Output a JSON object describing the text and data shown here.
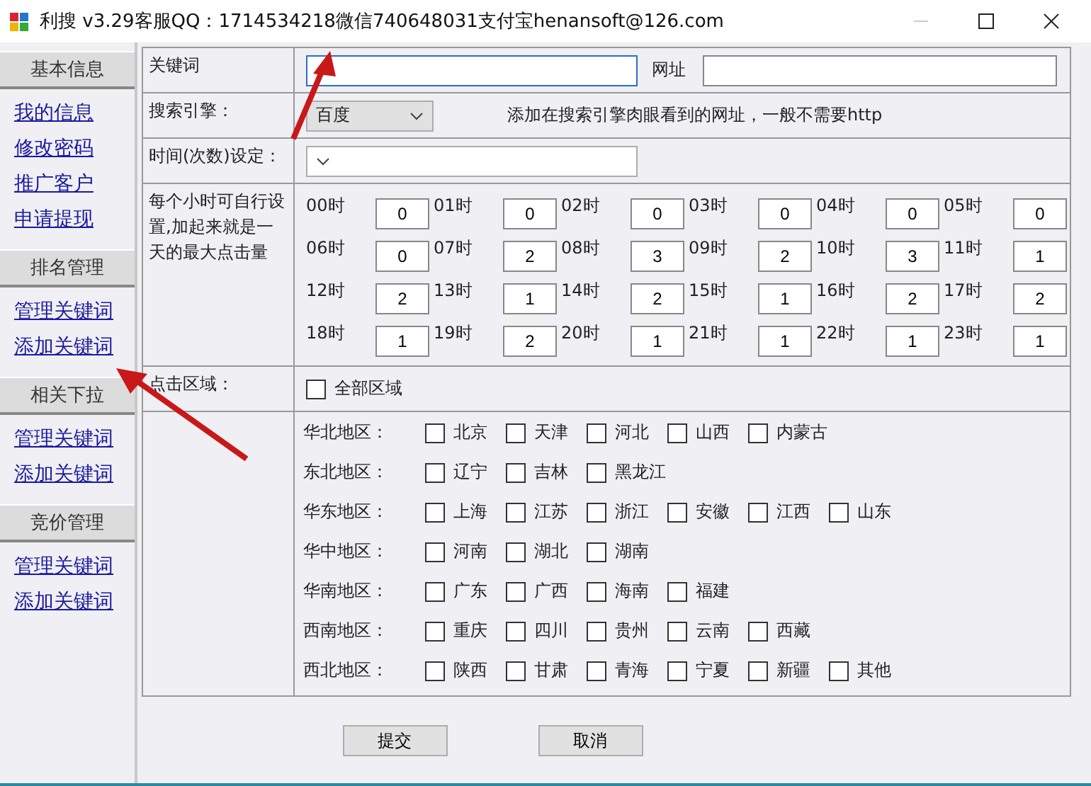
{
  "window": {
    "title": "利搜 v3.29客服QQ：1714534218微信740648031支付宝henansoft@126.com"
  },
  "sidebar": {
    "sections": [
      {
        "title": "基本信息",
        "links": [
          "我的信息",
          "修改密码",
          "推广客户",
          "申请提现"
        ]
      },
      {
        "title": "排名管理",
        "links": [
          "管理关键词",
          "添加关键词"
        ]
      },
      {
        "title": "相关下拉",
        "links": [
          "管理关键词",
          "添加关键词"
        ]
      },
      {
        "title": "竞价管理",
        "links": [
          "管理关键词",
          "添加关键词"
        ]
      }
    ]
  },
  "form": {
    "keyword": {
      "label": "关键词"
    },
    "url": {
      "label": "网址"
    },
    "engine": {
      "label": "搜索引擎：",
      "value": "百度",
      "hint": "添加在搜索引擎肉眼看到的网址，一般不需要http"
    },
    "time": {
      "label": "时间(次数)设定："
    },
    "hours_note": "每个小时可自行设置,加起来就是一天的最大点击量",
    "hours": [
      {
        "label": "00时",
        "value": "0"
      },
      {
        "label": "01时",
        "value": "0"
      },
      {
        "label": "02时",
        "value": "0"
      },
      {
        "label": "03时",
        "value": "0"
      },
      {
        "label": "04时",
        "value": "0"
      },
      {
        "label": "05时",
        "value": "0"
      },
      {
        "label": "06时",
        "value": "0"
      },
      {
        "label": "07时",
        "value": "2"
      },
      {
        "label": "08时",
        "value": "3"
      },
      {
        "label": "09时",
        "value": "2"
      },
      {
        "label": "10时",
        "value": "3"
      },
      {
        "label": "11时",
        "value": "1"
      },
      {
        "label": "12时",
        "value": "2"
      },
      {
        "label": "13时",
        "value": "1"
      },
      {
        "label": "14时",
        "value": "2"
      },
      {
        "label": "15时",
        "value": "1"
      },
      {
        "label": "16时",
        "value": "2"
      },
      {
        "label": "17时",
        "value": "2"
      },
      {
        "label": "18时",
        "value": "1"
      },
      {
        "label": "19时",
        "value": "2"
      },
      {
        "label": "20时",
        "value": "1"
      },
      {
        "label": "21时",
        "value": "1"
      },
      {
        "label": "22时",
        "value": "1"
      },
      {
        "label": "23时",
        "value": "1"
      }
    ],
    "click_area": {
      "label": "点击区域：",
      "all": {
        "label": "全部区域",
        "checked": false
      }
    },
    "regions": [
      {
        "name": "华北地区：",
        "provinces": [
          {
            "name": "北京",
            "checked": false
          },
          {
            "name": "天津",
            "checked": false
          },
          {
            "name": "河北",
            "checked": false
          },
          {
            "name": "山西",
            "checked": false
          },
          {
            "name": "内蒙古",
            "checked": false
          }
        ]
      },
      {
        "name": "东北地区：",
        "provinces": [
          {
            "name": "辽宁",
            "checked": false
          },
          {
            "name": "吉林",
            "checked": false
          },
          {
            "name": "黑龙江",
            "checked": false
          }
        ]
      },
      {
        "name": "华东地区：",
        "provinces": [
          {
            "name": "上海",
            "checked": false
          },
          {
            "name": "江苏",
            "checked": false
          },
          {
            "name": "浙江",
            "checked": false
          },
          {
            "name": "安徽",
            "checked": false
          },
          {
            "name": "江西",
            "checked": false
          },
          {
            "name": "山东",
            "checked": false
          }
        ]
      },
      {
        "name": "华中地区：",
        "provinces": [
          {
            "name": "河南",
            "checked": false
          },
          {
            "name": "湖北",
            "checked": false
          },
          {
            "name": "湖南",
            "checked": false
          }
        ]
      },
      {
        "name": "华南地区：",
        "provinces": [
          {
            "name": "广东",
            "checked": false
          },
          {
            "name": "广西",
            "checked": false
          },
          {
            "name": "海南",
            "checked": false
          },
          {
            "name": "福建",
            "checked": false
          }
        ]
      },
      {
        "name": "西南地区：",
        "provinces": [
          {
            "name": "重庆",
            "checked": false
          },
          {
            "name": "四川",
            "checked": false
          },
          {
            "name": "贵州",
            "checked": false
          },
          {
            "name": "云南",
            "checked": false
          },
          {
            "name": "西藏",
            "checked": false
          }
        ]
      },
      {
        "name": "西北地区：",
        "provinces": [
          {
            "name": "陕西",
            "checked": false
          },
          {
            "name": "甘肃",
            "checked": false
          },
          {
            "name": "青海",
            "checked": false
          },
          {
            "name": "宁夏",
            "checked": false
          },
          {
            "name": "新疆",
            "checked": false
          },
          {
            "name": "其他",
            "checked": false
          }
        ]
      }
    ]
  },
  "buttons": [
    "提交",
    "取消"
  ]
}
